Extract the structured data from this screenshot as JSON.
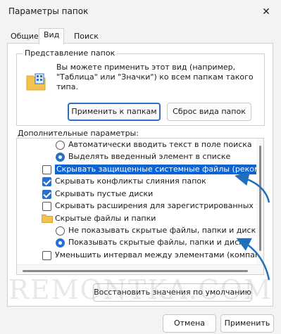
{
  "window": {
    "title": "Параметры папок"
  },
  "tabs": [
    {
      "label": "Общие",
      "active": false
    },
    {
      "label": "Вид",
      "active": true
    },
    {
      "label": "Поиск",
      "active": false
    }
  ],
  "folder_views": {
    "legend": "Представление папок",
    "description": "Вы можете применить этот вид (например, \"Таблица\" или \"Значки\") ко всем папкам такого типа.",
    "apply_label": "Применить к папкам",
    "reset_label": "Сброс вида папок"
  },
  "advanced": {
    "label": "Дополнительные параметры:",
    "items": [
      {
        "kind": "radio",
        "checked": false,
        "label": "Автоматически вводить текст в поле поиска"
      },
      {
        "kind": "radio",
        "checked": true,
        "label": "Выделять введенный элемент в списке"
      },
      {
        "kind": "checkbox",
        "checked": false,
        "selected": true,
        "label": "Скрывать защищенные системные файлы (рекомен"
      },
      {
        "kind": "checkbox",
        "checked": true,
        "label": "Скрывать конфликты слияния папок"
      },
      {
        "kind": "checkbox",
        "checked": true,
        "label": "Скрывать пустые диски"
      },
      {
        "kind": "checkbox",
        "checked": false,
        "label": "Скрывать расширения для зарегистрированных типо"
      },
      {
        "kind": "folder",
        "label": "Скрытые файлы и папки"
      },
      {
        "kind": "radio",
        "checked": false,
        "label": "Не показывать скрытые файлы, папки и диски"
      },
      {
        "kind": "radio",
        "checked": true,
        "label": "Показывать скрытые файлы, папки и диски"
      },
      {
        "kind": "checkbox",
        "checked": false,
        "label": "Уменьшить интервал между элементами (компакт"
      }
    ]
  },
  "restore_label": "Восстановить значения по умолчанию",
  "footer": {
    "cancel_label": "Отмена",
    "apply_label": "Применить"
  },
  "watermark": "REMONTKA.COM",
  "colors": {
    "accent": "#2a6fc9",
    "selection": "#0a64d6",
    "annotation_arrow": "#1f6fbd"
  },
  "icons": {
    "close": "close-icon",
    "folder": "folder-icon",
    "small_folder": "small-folder-icon"
  }
}
